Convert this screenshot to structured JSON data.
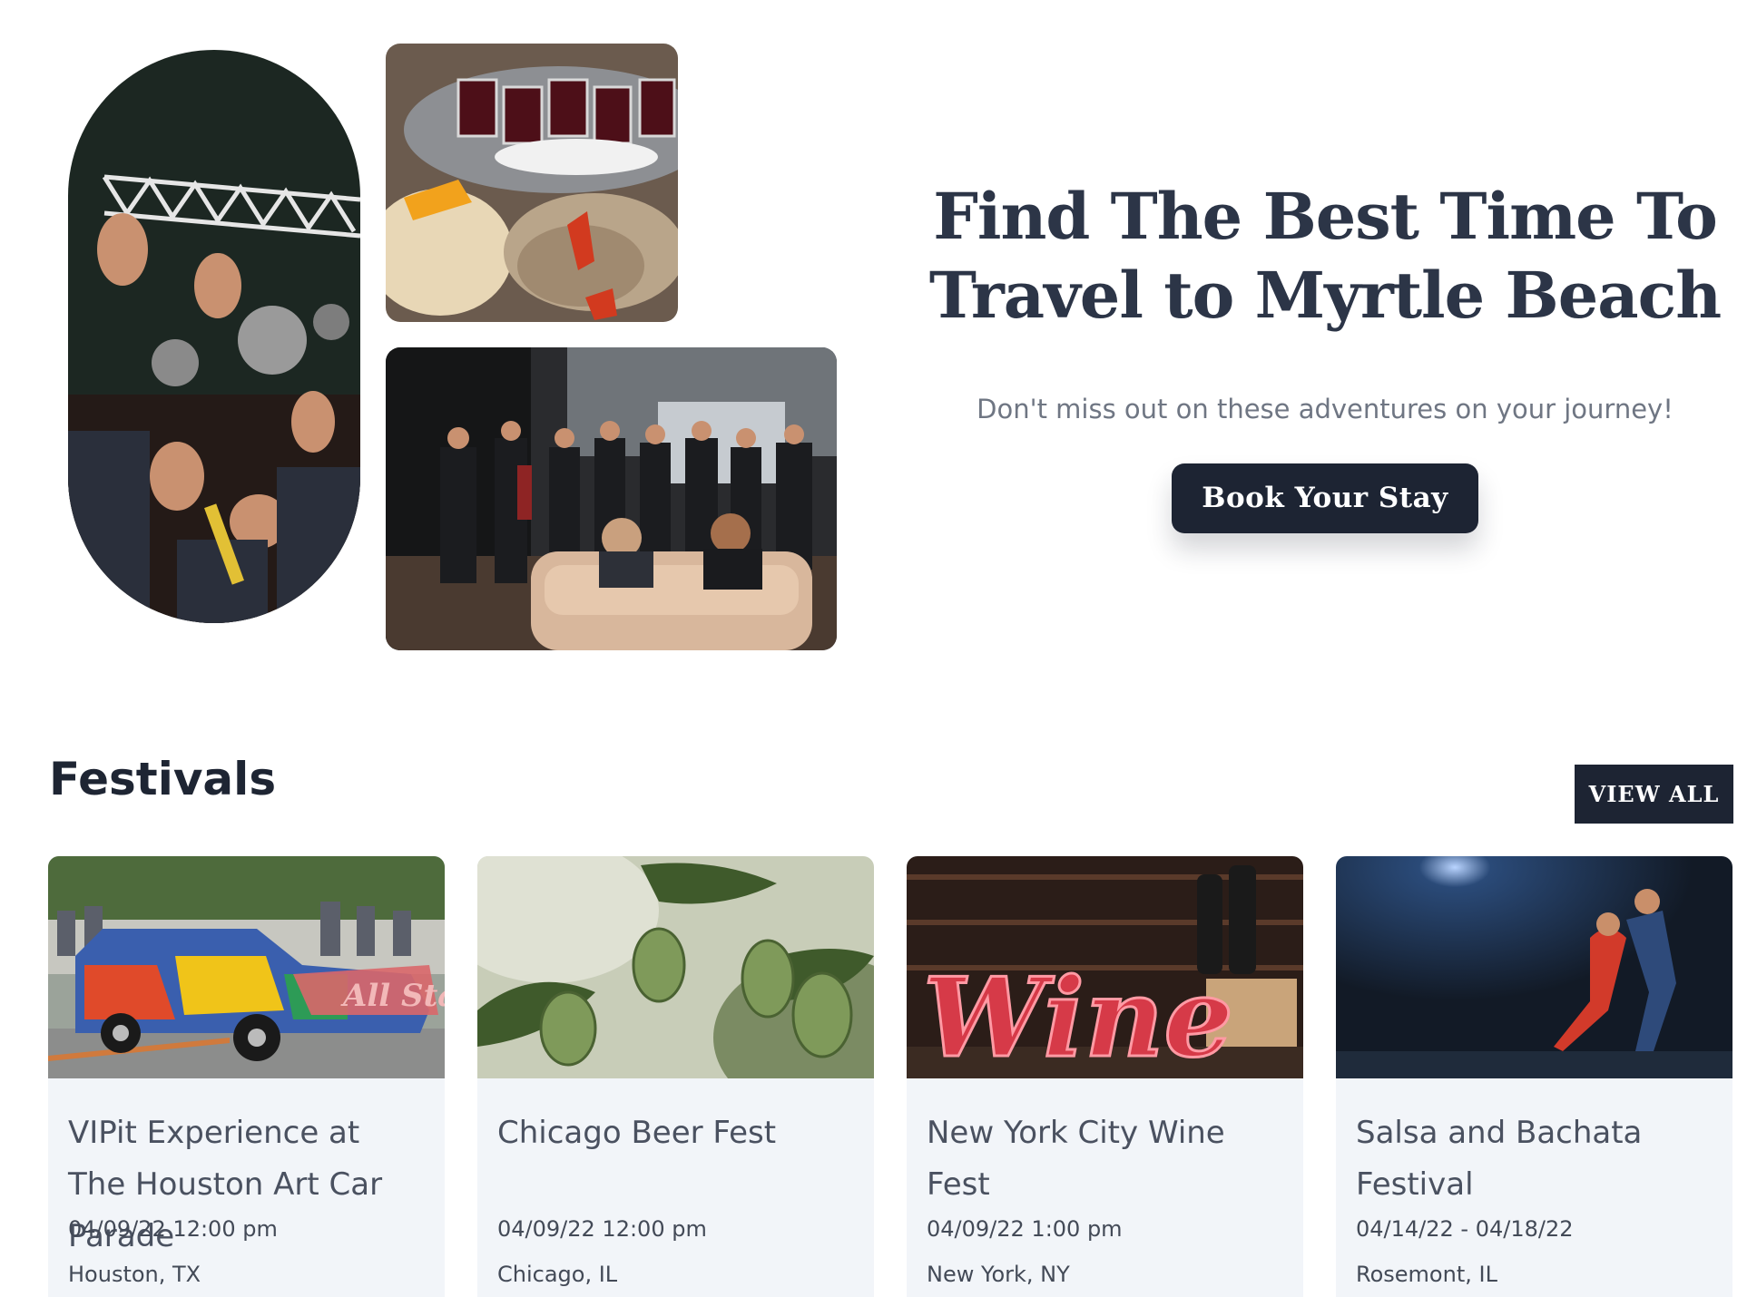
{
  "hero": {
    "title_line1": "Find The Best Time To",
    "title_line2": "Travel to Myrtle Beach",
    "subtitle": "Don't miss out on these adventures on your journey!",
    "cta_label": "Book Your Stay"
  },
  "festivals": {
    "heading": "Festivals",
    "view_all_label": "VIEW ALL",
    "cards": [
      {
        "title": "VIPit Experience at The Houston Art Car Parade",
        "date": "04/09/22 12:00 pm",
        "location": "Houston, TX"
      },
      {
        "title": "Chicago Beer Fest",
        "date": "04/09/22 12:00 pm",
        "location": "Chicago, IL"
      },
      {
        "title": "New York City Wine Fest",
        "date": "04/09/22 1:00 pm",
        "location": "New York, NY"
      },
      {
        "title": "Salsa and Bachata Festival",
        "date": "04/14/22 - 04/18/22",
        "location": "Rosemont, IL"
      }
    ]
  },
  "images": {
    "wine_sign_text": "Wine",
    "art_car_banner_text": "All Star"
  },
  "colors": {
    "primary_dark": "#1d2433",
    "heading": "#2c3547",
    "card_bg": "#f2f5f9"
  }
}
